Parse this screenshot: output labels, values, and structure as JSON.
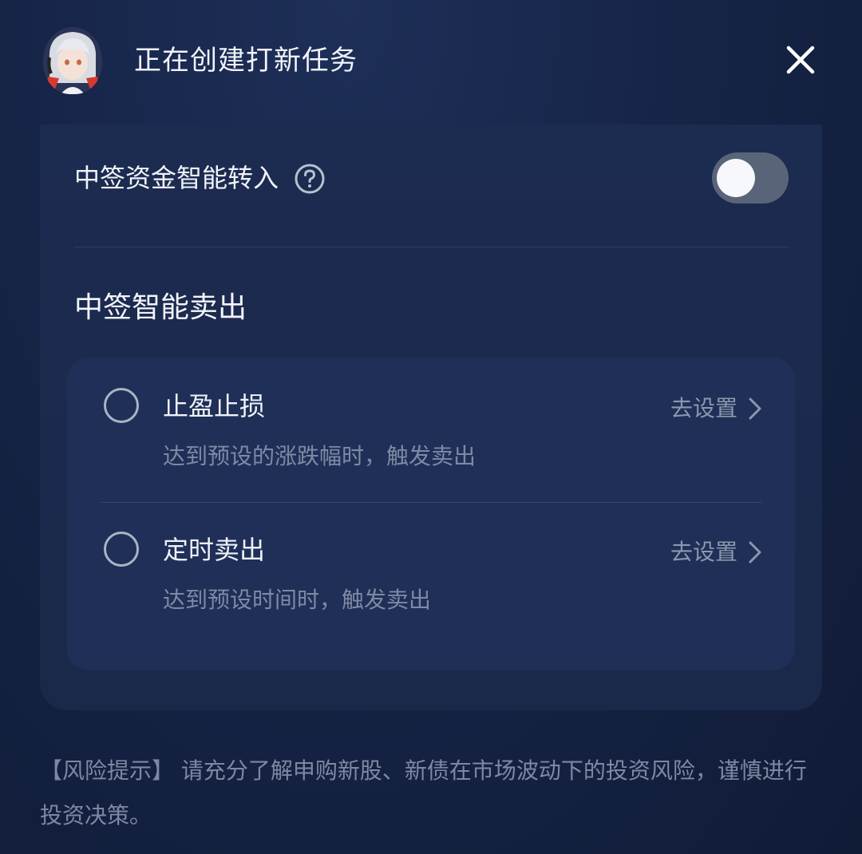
{
  "header": {
    "title": "正在创建打新任务",
    "avatar_icon": "assistant-avatar",
    "close_icon": "close-icon"
  },
  "auto_transfer": {
    "label": "中签资金智能转入",
    "help_icon": "question-circle-icon",
    "enabled": false
  },
  "smart_sell": {
    "title": "中签智能卖出",
    "options": [
      {
        "title": "止盈止损",
        "description": "达到预设的涨跌幅时，触发卖出",
        "action_label": "去设置",
        "selected": false
      },
      {
        "title": "定时卖出",
        "description": "达到预设时间时，触发卖出",
        "action_label": "去设置",
        "selected": false
      }
    ]
  },
  "risk_notice": "【风险提示】 请充分了解申购新股、新债在市场波动下的投资风险，谨慎进行投资决策。",
  "colors": {
    "background": "#162447",
    "panel": "#1c2b50",
    "options_card": "#1f2f58",
    "toggle_off": "#5a6478",
    "muted_text": "#7e89a3"
  }
}
